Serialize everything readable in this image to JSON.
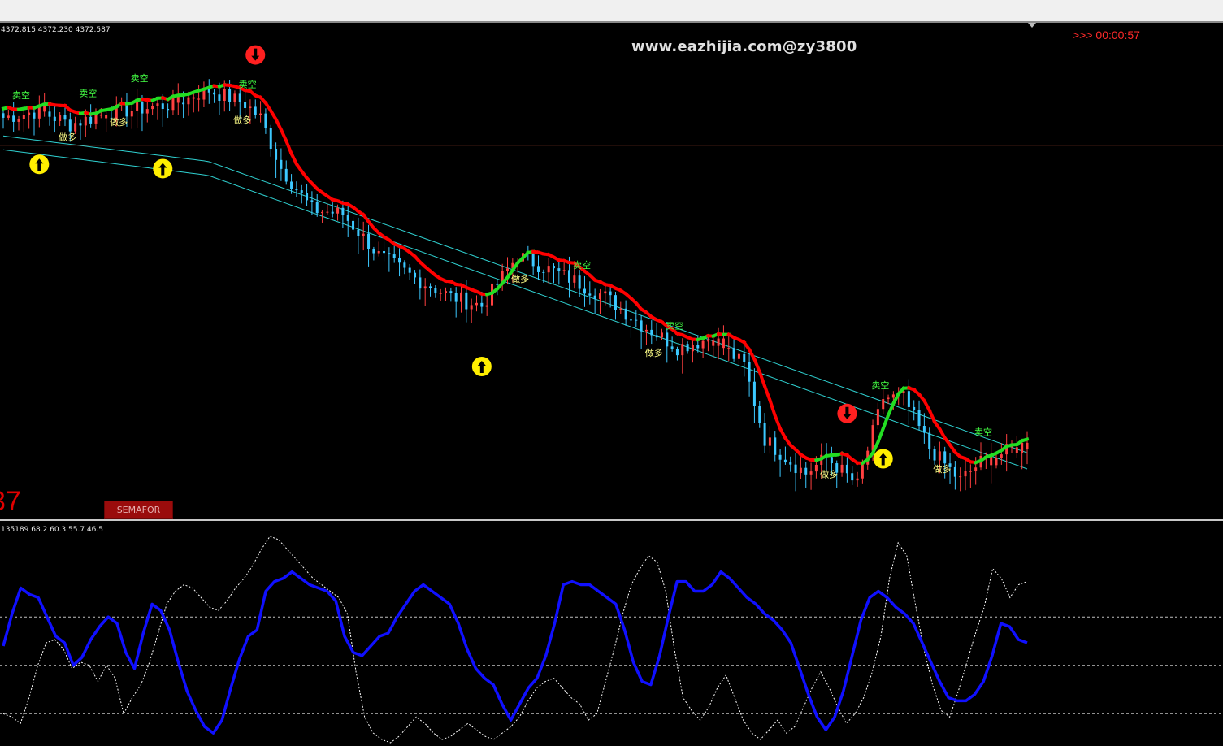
{
  "watermark": "www.eazhijia.com@zy3800",
  "timer": ">>> 00:00:57",
  "ohlc_readout": "4372.815 4372.230 4372.587",
  "subwindow_readout": "135189 68.2 60.3 55.7 46.5",
  "price_readout_partial": "37",
  "semafor_button": "SEMAFOR",
  "labels": {
    "sell": "卖空",
    "buy": "做多"
  },
  "colors": {
    "background": "#000000",
    "bull_candle": "#ff4040",
    "bear_candle": "#3cc8ff",
    "trend_down": "#ff0000",
    "trend_up": "#22dd22",
    "envelope": "#2fd0d0",
    "hline_upper": "#ff6a4a",
    "hline_lower": "#a8d8e8",
    "oscillator_main": "#1010ff",
    "oscillator_signal": "#ffffff",
    "semafor_buy": "#ffee00",
    "semafor_sell": "#ff2020"
  },
  "chart_data": [
    {
      "type": "candlestick",
      "description_free": true,
      "title": "",
      "xlabel": "",
      "ylabel": "",
      "bars": 200,
      "close_path": [
        [
          0,
          100
        ],
        [
          7,
          103
        ],
        [
          13,
          97
        ],
        [
          20,
          102
        ],
        [
          27,
          104
        ],
        [
          33,
          106
        ],
        [
          40,
          112
        ],
        [
          47,
          106
        ],
        [
          50,
          100
        ],
        [
          54,
          78
        ],
        [
          60,
          60
        ],
        [
          66,
          58
        ],
        [
          73,
          40
        ],
        [
          80,
          30
        ],
        [
          87,
          22
        ],
        [
          93,
          18
        ],
        [
          100,
          40
        ],
        [
          104,
          36
        ],
        [
          110,
          30
        ],
        [
          117,
          22
        ],
        [
          124,
          10
        ],
        [
          131,
          0
        ],
        [
          138,
          4
        ],
        [
          144,
          -8
        ],
        [
          148,
          -40
        ],
        [
          152,
          -48
        ],
        [
          156,
          -55
        ],
        [
          160,
          -48
        ],
        [
          166,
          -60
        ],
        [
          171,
          -22
        ],
        [
          175,
          -22
        ],
        [
          180,
          -44
        ],
        [
          186,
          -58
        ],
        [
          190,
          -50
        ],
        [
          199,
          -42
        ]
      ],
      "envelope_upper_start": 92,
      "envelope_upper_end": -46,
      "envelope_lower_start": 86,
      "envelope_lower_end": -53,
      "hline_upper_level": 88,
      "hline_lower_level": -50,
      "semafor_buy_bars": [
        7,
        31,
        93,
        171
      ],
      "semafor_sell_bars": [
        49,
        164
      ],
      "sell_label_bars": [
        3,
        16,
        26,
        47,
        112,
        130,
        170,
        190
      ],
      "buy_label_bars": [
        12,
        22,
        46,
        100,
        126,
        160,
        182
      ]
    },
    {
      "type": "line",
      "series": [
        {
          "values": [
            62,
            82,
            98,
            94,
            92,
            80,
            68,
            64,
            50,
            55,
            66,
            74,
            80,
            76,
            58,
            48,
            70,
            88,
            84,
            72,
            52,
            34,
            22,
            12,
            8,
            16,
            36,
            54,
            68,
            72,
            96,
            102,
            104,
            108,
            104,
            100,
            98,
            96,
            90,
            68,
            58,
            56,
            62,
            68,
            70,
            80,
            88,
            96,
            100,
            96,
            92,
            88,
            76,
            60,
            48,
            42,
            38,
            26,
            16,
            26,
            36,
            42,
            56,
            76,
            100,
            102,
            100,
            100,
            96,
            92,
            88,
            72,
            52,
            40,
            38,
            56,
            80,
            102,
            102,
            96,
            96,
            100,
            108,
            104,
            98,
            92,
            88,
            82,
            78,
            72,
            64,
            48,
            32,
            18,
            10,
            18,
            34,
            56,
            78,
            92,
            96,
            92,
            86,
            82,
            76,
            64,
            52,
            40,
            30,
            28,
            28,
            32,
            40,
            56,
            76,
            74,
            66,
            64
          ]
        },
        {
          "values": [
            20,
            18,
            14,
            30,
            50,
            64,
            66,
            60,
            48,
            52,
            50,
            40,
            50,
            42,
            20,
            30,
            38,
            52,
            70,
            88,
            96,
            100,
            98,
            92,
            86,
            84,
            90,
            98,
            104,
            112,
            122,
            130,
            128,
            122,
            116,
            110,
            104,
            100,
            96,
            92,
            82,
            46,
            18,
            8,
            4,
            2,
            6,
            12,
            18,
            14,
            8,
            4,
            6,
            10,
            14,
            10,
            6,
            4,
            8,
            12,
            18,
            28,
            36,
            40,
            42,
            36,
            30,
            26,
            16,
            20,
            40,
            60,
            82,
            100,
            110,
            118,
            114,
            96,
            60,
            30,
            22,
            16,
            24,
            36,
            44,
            30,
            16,
            8,
            4,
            10,
            16,
            8,
            12,
            24,
            36,
            46,
            36,
            24,
            14,
            20,
            30,
            46,
            68,
            104,
            126,
            118,
            88,
            60,
            38,
            22,
            18,
            34,
            52,
            70,
            86,
            110,
            104,
            92,
            100,
            102
          ]
        }
      ],
      "levels": [
        80,
        50,
        20
      ]
    }
  ]
}
